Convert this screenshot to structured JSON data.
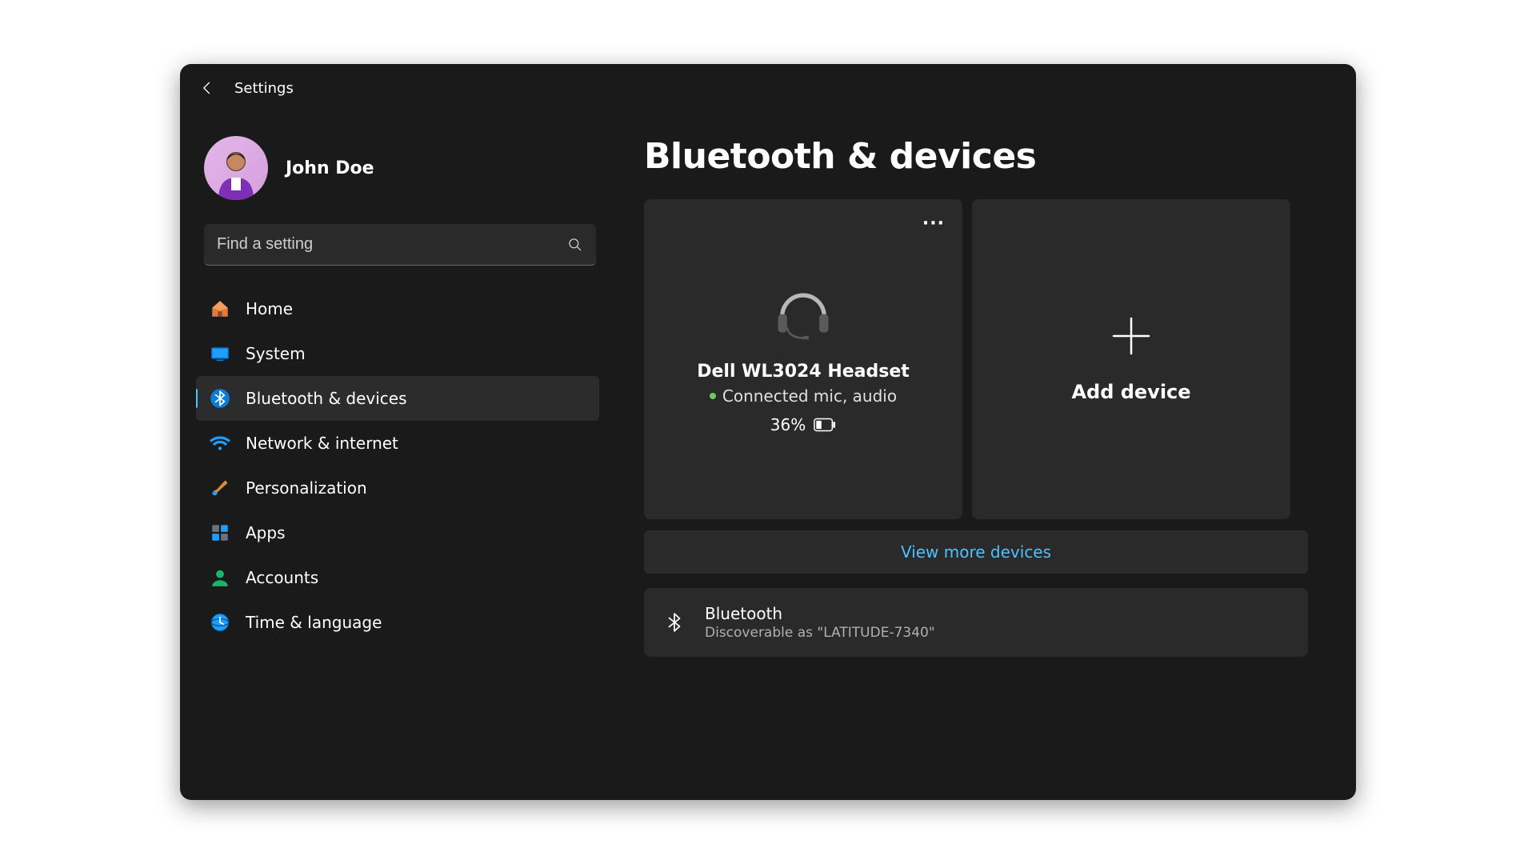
{
  "header": {
    "title": "Settings"
  },
  "user": {
    "name": "John Doe"
  },
  "search": {
    "placeholder": "Find a setting"
  },
  "sidebar": {
    "items": [
      {
        "label": "Home"
      },
      {
        "label": "System"
      },
      {
        "label": "Bluetooth & devices"
      },
      {
        "label": "Network & internet"
      },
      {
        "label": "Personalization"
      },
      {
        "label": "Apps"
      },
      {
        "label": "Accounts"
      },
      {
        "label": "Time & language"
      }
    ]
  },
  "main": {
    "title": "Bluetooth & devices",
    "device": {
      "name": "Dell WL3024 Headset",
      "status": "Connected mic, audio",
      "battery_pct": "36%"
    },
    "add_device_label": "Add device",
    "more_link": "View more devices",
    "bluetooth": {
      "title": "Bluetooth",
      "subtitle": "Discoverable as \"LATITUDE-7340\""
    }
  }
}
